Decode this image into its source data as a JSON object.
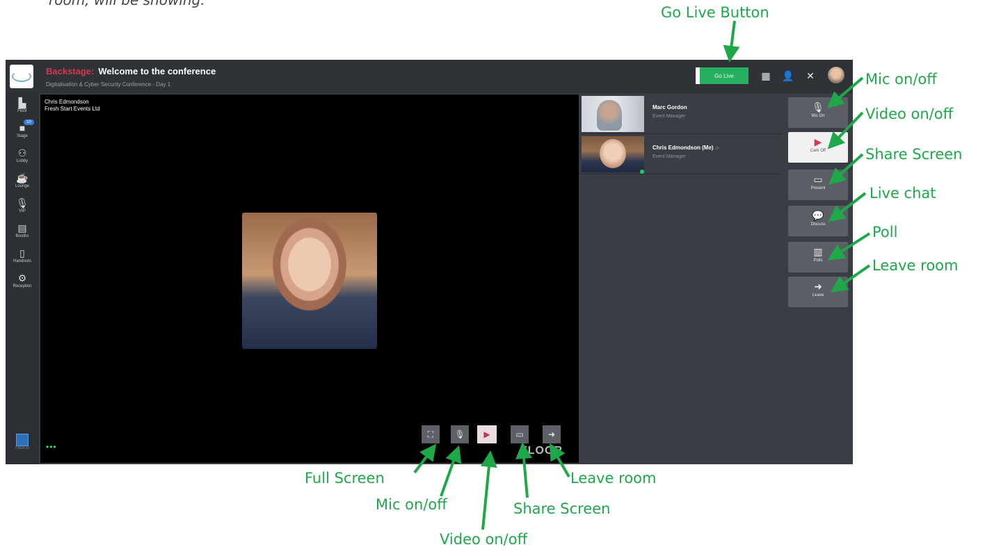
{
  "document": {
    "fragment_text": "room, will be showing."
  },
  "topbar": {
    "backstage_label": "Backstage:",
    "title": "Welcome to the conference",
    "subtitle": "Digitalisation & Cyber Security Conference - Day 1",
    "go_live_label": "Go Live",
    "icons": [
      "grid-icon",
      "add-user-icon",
      "tools-icon",
      "user-avatar"
    ]
  },
  "left_nav": {
    "items": [
      {
        "label": "Floor",
        "icon": "map-icon"
      },
      {
        "label": "Stage",
        "icon": "stage-icon",
        "badge": "10"
      },
      {
        "label": "Lobby",
        "icon": "people-icon"
      },
      {
        "label": "Lounge",
        "icon": "coffee-icon"
      },
      {
        "label": "VIP",
        "icon": "mic-icon"
      },
      {
        "label": "Booths",
        "icon": "booth-icon"
      },
      {
        "label": "Handouts",
        "icon": "document-icon"
      },
      {
        "label": "Reception",
        "icon": "robot-icon"
      }
    ],
    "bottom_label": "Floor.io"
  },
  "stage": {
    "speaker_name": "Chris Edmondson",
    "speaker_company": "Fresh Start Events Ltd",
    "more_label": "•••",
    "watermark": "FLOOR"
  },
  "participants": [
    {
      "name": "Marc Gordon",
      "role": "Event Manager",
      "suffix": ""
    },
    {
      "name": "Chris Edmondson (Me)",
      "role": "Event Manager",
      "suffix": "2h"
    }
  ],
  "right_rail": [
    {
      "label": "Mic On",
      "icon": "mic-icon"
    },
    {
      "label": "Cam Off",
      "icon": "camera-off-icon"
    },
    {
      "label": "Present",
      "icon": "monitor-icon"
    },
    {
      "label": "Discuss",
      "icon": "chat-icon"
    },
    {
      "label": "Polls",
      "icon": "poll-icon"
    },
    {
      "label": "Leave",
      "icon": "leave-icon"
    }
  ],
  "annotations": {
    "go_live": "Go Live Button",
    "mic_right": "Mic on/off",
    "video_right": "Video on/off",
    "share_right": "Share Screen",
    "chat_right": "Live chat",
    "poll_right": "Poll",
    "leave_right": "Leave room",
    "full_screen": "Full Screen",
    "mic_bottom": "Mic on/off",
    "video_bottom": "Video on/off",
    "share_bottom": "Share Screen",
    "leave_bottom": "Leave room"
  },
  "colors": {
    "accent_live": "#27ae60",
    "backstage_red": "#d33a4b",
    "annotation_green": "#1fa84a"
  }
}
